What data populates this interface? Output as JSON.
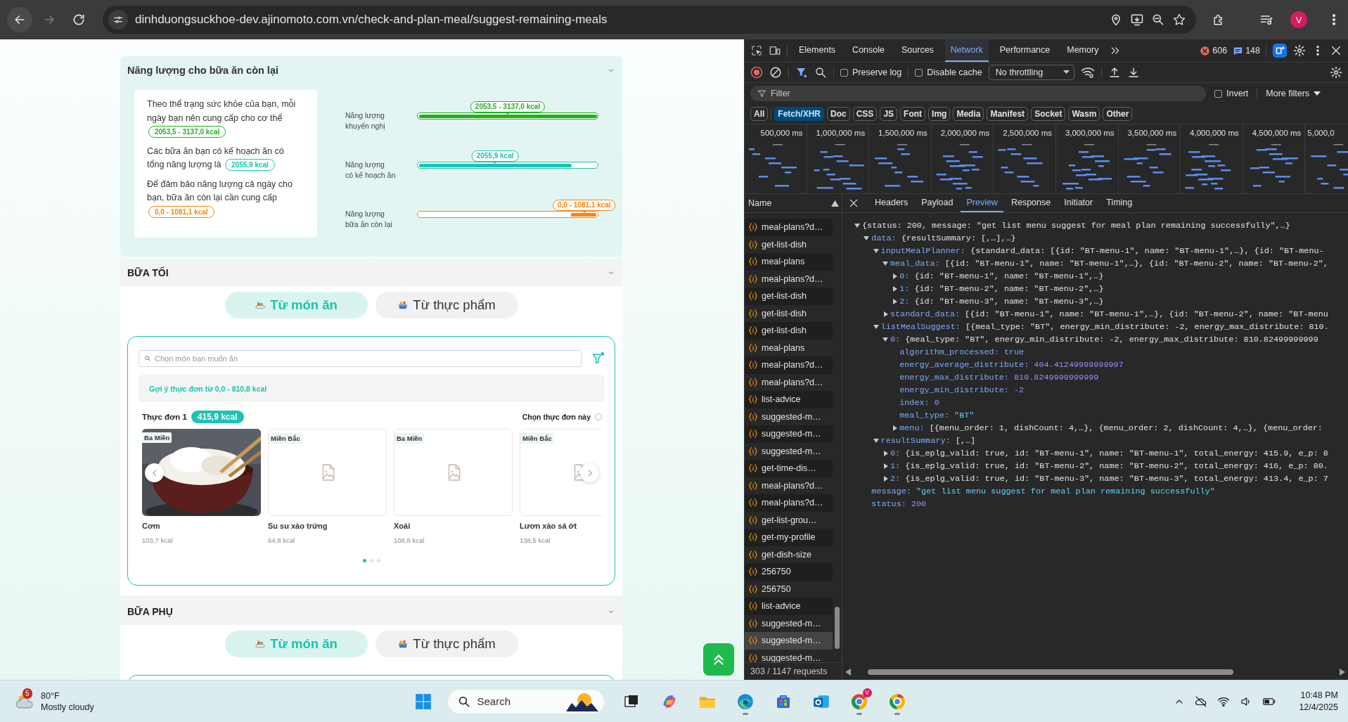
{
  "browser": {
    "nav": [
      {
        "kind": "back",
        "disabled": false
      },
      {
        "kind": "forward",
        "disabled": true
      },
      {
        "kind": "reload",
        "disabled": false
      }
    ],
    "url": "dinhduongsuckhoe-dev.ajinomoto.com.vn/check-and-plan-meal/suggest-remaining-meals",
    "profile": "V"
  },
  "energy": {
    "title": "Năng lượng cho bữa ăn còn lại",
    "statements": [
      {
        "text": "Theo thể trạng sức khỏe của bạn, mỗi ngày bạn nên cung cấp cho cơ thể",
        "badge": "2053,5 - 3137,0 kcal",
        "color": "#22b01f"
      },
      {
        "text": "Các bữa ăn bạn có kế hoạch ăn có tổng năng lượng là",
        "badge": "2055,9 kcal",
        "color": "#1cc3b2"
      },
      {
        "text": "Để đảm bảo năng lượng cả ngày cho bạn, bữa ăn còn lại cần cung cấp",
        "badge": "0,0 - 1081,1 kcal",
        "color": "#f7850f"
      }
    ],
    "bars": [
      {
        "label_lines": [
          "Năng lượng",
          "khuyến nghị"
        ],
        "value": "2053,5 - 3137,0 kcal",
        "level": 1,
        "kind": "from-start",
        "color": "#22b01f"
      },
      {
        "label_lines": [
          "Năng lượng",
          "có kế hoạch ăn"
        ],
        "value": "2055,9 kcal",
        "level": 0.86,
        "kind": "from-start",
        "color": "#1cc3b2"
      },
      {
        "label_lines": [
          "Năng lượng",
          "bữa ăn còn lại"
        ],
        "value": "0,0 - 1081,1 kcal",
        "level": 0.15,
        "kind": "from-end",
        "color": "#f7850f"
      }
    ]
  },
  "meals": [
    {
      "title": "BỮA TỐI",
      "modes": [
        {
          "label": "Từ món ăn",
          "kind": "dish",
          "selected": true
        },
        {
          "label": "Từ thực phẩm",
          "kind": "food",
          "selected": false
        }
      ],
      "panel": {
        "placeholder": "Chọn món bạn muốn ăn",
        "suggestion": "Gợi ý thực đơn từ 0,0 - 810,8 kcal",
        "menu_title": "Thực đơn 1",
        "menu_kcal": "415,9 kcal",
        "choose_label": "Chọn thực đơn này",
        "checked": false,
        "dishes": [
          {
            "region": "Ba Miền",
            "name": "Cơm",
            "kcal": "103,7 kcal"
          },
          {
            "region": "Miền Bắc",
            "name": "Su su xào trứng",
            "kcal": "64,8 kcal",
            "kind": "placeholder"
          },
          {
            "region": "Ba Miền",
            "name": "Xoài",
            "kcal": "108,8 kcal",
            "kind": "placeholder"
          },
          {
            "region": "Miền Bắc",
            "name": "Lươn xào sả ớt",
            "kcal": "138,5 kcal",
            "kind": "placeholder"
          }
        ],
        "dots": [
          {
            "selected": true
          },
          {
            "selected": false
          },
          {
            "selected": false
          }
        ]
      }
    },
    {
      "title": "BỮA PHỤ",
      "modes": [
        {
          "label": "Từ món ăn",
          "kind": "dish",
          "selected": true
        },
        {
          "label": "Từ thực phẩm",
          "kind": "food",
          "selected": false
        }
      ]
    }
  ],
  "devtools": {
    "tabs": [
      {
        "label": "Elements",
        "selected": false
      },
      {
        "label": "Console",
        "selected": false
      },
      {
        "label": "Sources",
        "selected": false
      },
      {
        "label": "Network",
        "selected": true
      },
      {
        "label": "Performance",
        "selected": false
      },
      {
        "label": "Memory",
        "selected": false
      }
    ],
    "errors": "606",
    "messages": "148",
    "recording": true,
    "preserve_log": {
      "label": "Preserve log",
      "checked": false
    },
    "disable_cache": {
      "label": "Disable cache",
      "checked": false
    },
    "throttling": "No throttling",
    "filter": {
      "placeholder": "Filter",
      "invert": {
        "label": "Invert",
        "checked": false
      },
      "more_filters": "More filters"
    },
    "types": [
      {
        "label": "All",
        "selected": false
      },
      {
        "label": "Fetch/XHR",
        "selected": true
      },
      {
        "label": "Doc",
        "selected": false
      },
      {
        "label": "CSS",
        "selected": false
      },
      {
        "label": "JS",
        "selected": false
      },
      {
        "label": "Font",
        "selected": false
      },
      {
        "label": "Img",
        "selected": false
      },
      {
        "label": "Media",
        "selected": false
      },
      {
        "label": "Manifest",
        "selected": false
      },
      {
        "label": "Socket",
        "selected": false
      },
      {
        "label": "Wasm",
        "selected": false
      },
      {
        "label": "Other",
        "selected": false
      }
    ],
    "timeline_ticks": [
      "500,000 ms",
      "1,000,000 ms",
      "1,500,000 ms",
      "2,000,000 ms",
      "2,500,000 ms",
      "3,000,000 ms",
      "3,500,000 ms",
      "4,000,000 ms",
      "4,500,000 ms",
      "5,000,0"
    ],
    "name_header": "Name",
    "requests": [
      {
        "name": "meal-plans?d…",
        "selected": false
      },
      {
        "name": "get-list-dish",
        "selected": false
      },
      {
        "name": "meal-plans",
        "selected": false
      },
      {
        "name": "meal-plans?d…",
        "selected": false
      },
      {
        "name": "get-list-dish",
        "selected": false
      },
      {
        "name": "get-list-dish",
        "selected": false
      },
      {
        "name": "get-list-dish",
        "selected": false
      },
      {
        "name": "meal-plans",
        "selected": false
      },
      {
        "name": "meal-plans?d…",
        "selected": false
      },
      {
        "name": "meal-plans?d…",
        "selected": false
      },
      {
        "name": "list-advice",
        "selected": false
      },
      {
        "name": "suggested-m…",
        "selected": false
      },
      {
        "name": "suggested-m…",
        "selected": false
      },
      {
        "name": "suggested-m…",
        "selected": false
      },
      {
        "name": "get-time-dis…",
        "selected": false
      },
      {
        "name": "meal-plans?d…",
        "selected": false
      },
      {
        "name": "meal-plans?d…",
        "selected": false
      },
      {
        "name": "get-list-grou…",
        "selected": false
      },
      {
        "name": "get-my-profile",
        "selected": false
      },
      {
        "name": "get-dish-size",
        "selected": false
      },
      {
        "name": "256750",
        "selected": false
      },
      {
        "name": "256750",
        "selected": false
      },
      {
        "name": "list-advice",
        "selected": false
      },
      {
        "name": "suggested-m…",
        "selected": false
      },
      {
        "name": "suggested-m…",
        "selected": true
      },
      {
        "name": "suggested-m…",
        "selected": false
      }
    ],
    "footer": "303 / 1147 requests",
    "detail_tabs": [
      {
        "label": "Headers",
        "selected": false
      },
      {
        "label": "Payload",
        "selected": false
      },
      {
        "label": "Preview",
        "selected": true
      },
      {
        "label": "Response",
        "selected": false
      },
      {
        "label": "Initiator",
        "selected": false
      },
      {
        "label": "Timing",
        "selected": false
      }
    ],
    "preview": {
      "value": "{status: 200, message: \"get list menu suggest for meal plan remaining successfully\",…}",
      "expanded": true,
      "children": [
        {
          "key": "data:",
          "value": "{resultSummary: [,…],…}",
          "expanded": true,
          "children": [
            {
              "key": "inputMealPlanner:",
              "value": "{standard_data: [{id: \"BT-menu-1\", name: \"BT-menu-1\",…}, {id: \"BT-menu-",
              "expanded": true,
              "children": [
                {
                  "key": "meal_data:",
                  "value": "[{id: \"BT-menu-1\", name: \"BT-menu-1\",…}, {id: \"BT-menu-2\", name: \"BT-menu-2\",",
                  "expanded": true,
                  "children": [
                    {
                      "key": "0:",
                      "value": "{id: \"BT-menu-1\", name: \"BT-menu-1\",…}",
                      "expanded": false
                    },
                    {
                      "key": "1:",
                      "value": "{id: \"BT-menu-2\", name: \"BT-menu-2\",…}",
                      "expanded": false
                    },
                    {
                      "key": "2:",
                      "value": "{id: \"BT-menu-3\", name: \"BT-menu-3\",…}",
                      "expanded": false
                    }
                  ]
                },
                {
                  "key": "standard_data:",
                  "value": "[{id: \"BT-menu-1\", name: \"BT-menu-1\",…}, {id: \"BT-menu-2\", name: \"BT-menu",
                  "expanded": false
                }
              ]
            },
            {
              "key": "listMealSuggest:",
              "value": "[{meal_type: \"BT\", energy_min_distribute: -2, energy_max_distribute: 810.",
              "expanded": true,
              "children": [
                {
                  "key": "0:",
                  "value": "{meal_type: \"BT\", energy_min_distribute: -2, energy_max_distribute: 810.82499999999",
                  "expanded": true,
                  "children": [
                    {
                      "key": "algorithm_processed:",
                      "value": "true",
                      "kind": "boolean"
                    },
                    {
                      "key": "energy_average_distribute:",
                      "value": "404.41249999999997",
                      "kind": "number"
                    },
                    {
                      "key": "energy_max_distribute:",
                      "value": "810.8249999999999",
                      "kind": "number"
                    },
                    {
                      "key": "energy_min_distribute:",
                      "value": "-2",
                      "kind": "number"
                    },
                    {
                      "key": "index:",
                      "value": "0",
                      "kind": "number"
                    },
                    {
                      "key": "meal_type:",
                      "value": "\"BT\"",
                      "kind": "string"
                    },
                    {
                      "key": "menu:",
                      "value": "[{menu_order: 1, dishCount: 4,…}, {menu_order: 2, dishCount: 4,…}, {menu_order:",
                      "expanded": false
                    }
                  ]
                }
              ]
            },
            {
              "key": "resultSummary:",
              "value": "[,…]",
              "expanded": true,
              "children": [
                {
                  "key": "0:",
                  "value": "{is_eplg_valid: true, id: \"BT-menu-1\", name: \"BT-menu-1\", total_energy: 415.9, e_p: 8",
                  "expanded": false
                },
                {
                  "key": "1:",
                  "value": "{is_eplg_valid: true, id: \"BT-menu-2\", name: \"BT-menu-2\", total_energy: 416, e_p: 80.",
                  "expanded": false
                },
                {
                  "key": "2:",
                  "value": "{is_eplg_valid: true, id: \"BT-menu-3\", name: \"BT-menu-3\", total_energy: 413.4, e_p: 7",
                  "expanded": false
                }
              ]
            }
          ]
        },
        {
          "key": "message:",
          "value": "\"get list menu suggest for meal plan remaining successfully\"",
          "kind": "string"
        },
        {
          "key": "status:",
          "value": "200",
          "kind": "number"
        }
      ]
    }
  },
  "taskbar": {
    "weather": {
      "badge": "5",
      "temperature": "80°F",
      "condition": "Mostly cloudy"
    },
    "search_placeholder": "Search",
    "apps": [
      {
        "kind": "task-view",
        "running": false
      },
      {
        "kind": "copilot",
        "running": false
      },
      {
        "kind": "folder",
        "running": false
      },
      {
        "kind": "edge",
        "running": true
      },
      {
        "kind": "store",
        "running": false
      },
      {
        "kind": "mail",
        "running": false
      },
      {
        "kind": "chrome",
        "running": true,
        "badge": "V"
      },
      {
        "kind": "browser",
        "running": true
      }
    ],
    "time": "10:48 PM",
    "date": "12/4/2025"
  }
}
